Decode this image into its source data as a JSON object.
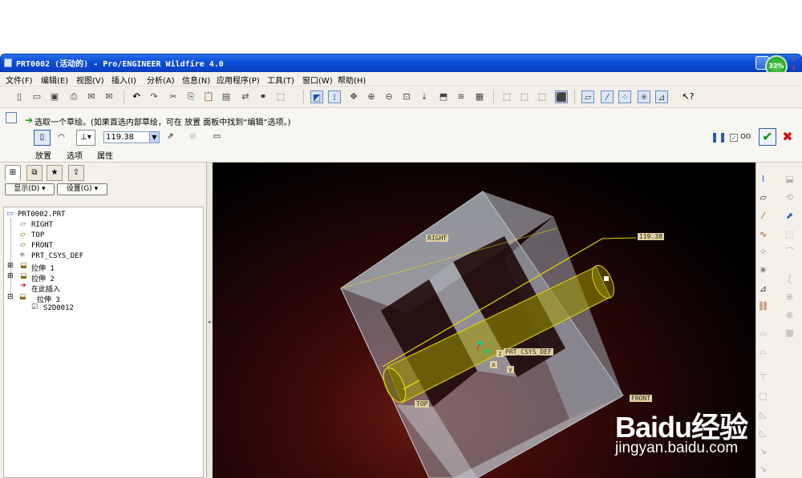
{
  "window": {
    "title": "PRT0002 (活动的) - Pro/ENGINEER Wildfire 4.0",
    "progress_badge": "32%"
  },
  "menu": [
    "文件(F)",
    "编辑(E)",
    "视图(V)",
    "插入(I)",
    "分析(A)",
    "信息(N)",
    "应用程序(P)",
    "工具(T)",
    "窗口(W)",
    "帮助(H)"
  ],
  "dashboard": {
    "prompt": "选取一个草绘。(如果首选内部草绘，可在 放置 面板中找到“编辑”选项。)",
    "depth_value": "119.38",
    "tabs": [
      "放置",
      "选项",
      "属性"
    ]
  },
  "navigator": {
    "show_button": "显示(D)",
    "settings_button": "设置(G)",
    "tree": [
      {
        "label": "PRT0002.PRT"
      },
      {
        "label": "RIGHT"
      },
      {
        "label": "TOP"
      },
      {
        "label": "FRONT"
      },
      {
        "label": "PRT_CSYS_DEF"
      },
      {
        "label": "拉伸 1"
      },
      {
        "label": "拉伸 2"
      },
      {
        "label": "在此插入"
      },
      {
        "label": "拉伸 3"
      },
      {
        "label": "S2D0012"
      }
    ]
  },
  "viewport": {
    "labels": {
      "right": "RIGHT",
      "top": "TOP",
      "front": "FRONT",
      "csys": "PRT_CSYS_DEF",
      "dimension": "119.38",
      "x": "x",
      "y": "y",
      "z": "z"
    }
  },
  "watermark": {
    "brand": "Baidu经验",
    "url": "jingyan.baidu.com"
  }
}
